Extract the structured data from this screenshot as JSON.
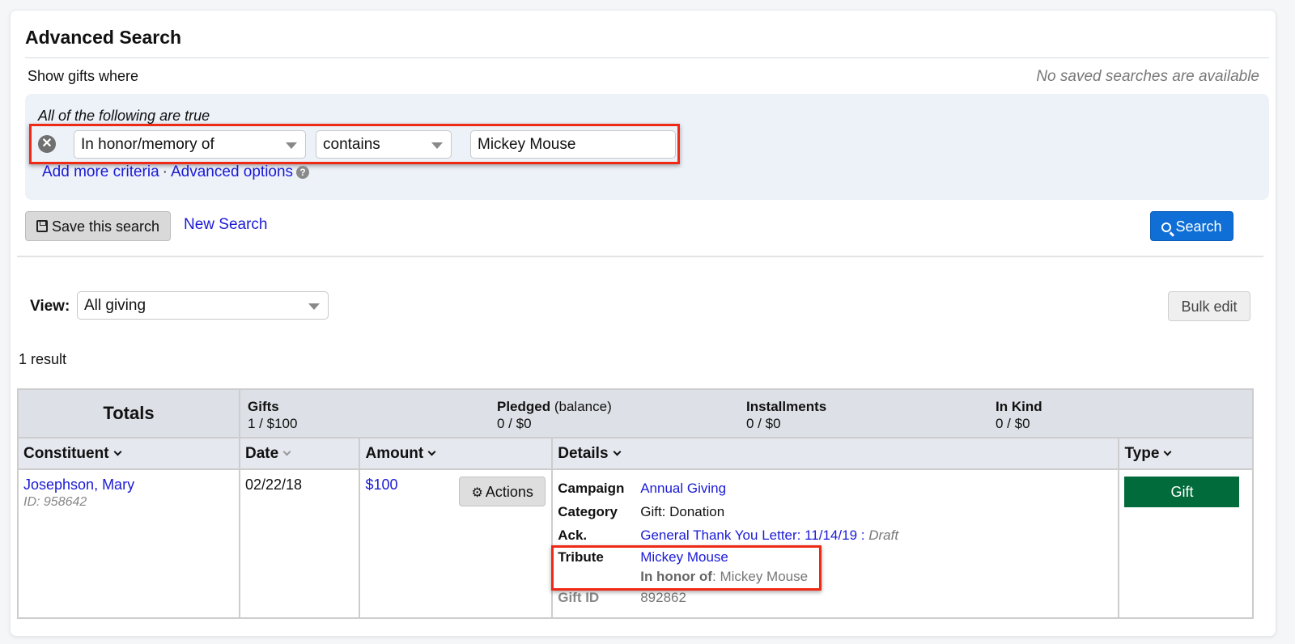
{
  "page": {
    "title": "Advanced Search",
    "show_where": "Show gifts where",
    "no_saved_searches": "No saved searches are available"
  },
  "criteria": {
    "group_label": "All of the following are true",
    "rows": [
      {
        "field": "In honor/memory of",
        "operator": "contains",
        "value": "Mickey Mouse",
        "remove_icon": "remove-circle-icon"
      }
    ],
    "add_more_label": "Add more criteria",
    "separator": "·",
    "advanced_options_label": "Advanced options",
    "help_icon": "?"
  },
  "actions": {
    "save_label": "Save this search",
    "save_icon": "floppy-disk-icon",
    "new_search_label": "New Search",
    "search_label": "Search",
    "search_icon": "magnifier-icon"
  },
  "view": {
    "label": "View:",
    "selected": "All giving",
    "bulk_edit_label": "Bulk edit"
  },
  "results": {
    "count_text": "1 result",
    "totals": {
      "label": "Totals",
      "gifts": {
        "title": "Gifts",
        "value": "1 / $100"
      },
      "pledged": {
        "title": "Pledged",
        "sub": "(balance)",
        "value": "0 / $0"
      },
      "installments": {
        "title": "Installments",
        "value": "0 / $0"
      },
      "in_kind": {
        "title": "In Kind",
        "value": "0 / $0"
      }
    },
    "columns": [
      "Constituent",
      "Date",
      "Amount",
      "Details",
      "Type"
    ],
    "rows": [
      {
        "constituent_name": "Josephson, Mary",
        "constituent_id": "ID: 958642",
        "date": "02/22/18",
        "amount": "$100",
        "actions_label": "Actions",
        "details": {
          "campaign_label": "Campaign",
          "campaign": "Annual Giving",
          "category_label": "Category",
          "category": "Gift: Donation",
          "ack_label": "Ack.",
          "ack": "General Thank You Letter: 11/14/19",
          "ack_sep": " : ",
          "ack_status": "Draft",
          "tribute_label": "Tribute",
          "tribute": "Mickey Mouse",
          "tribute_type_label": "In honor of",
          "tribute_type_sep": ": ",
          "tribute_honoree": "Mickey Mouse",
          "gift_id_label": "Gift ID",
          "gift_id": "892862"
        },
        "type": "Gift"
      }
    ]
  },
  "colors": {
    "link": "#1a1ad6",
    "search_button": "#0f6fd6",
    "gift_badge": "#026b3c",
    "highlight": "#ee2a16",
    "criteria_bg": "#edf1f8",
    "table_header_bg": "#dde0e6"
  }
}
